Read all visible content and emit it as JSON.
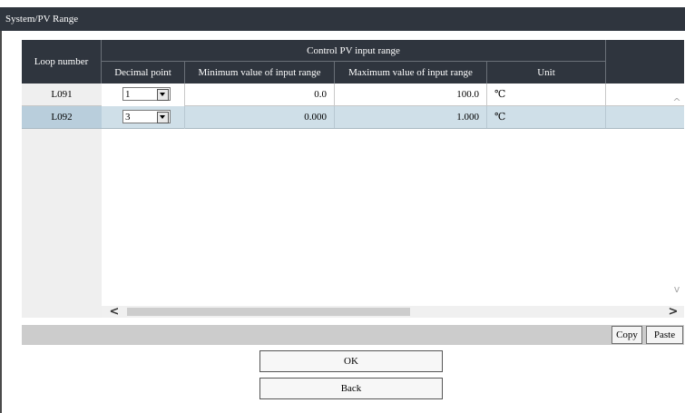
{
  "window": {
    "title": "System/PV Range"
  },
  "table": {
    "headers": {
      "loop_number": "Loop number",
      "group": "Control PV input range",
      "decimal_point": "Decimal point",
      "min_range": "Minimum value of input range",
      "max_range": "Maximum value of input range",
      "unit": "Unit"
    },
    "rows": [
      {
        "loop": "L091",
        "decimal_point": "1",
        "min": "0.0",
        "max": "100.0",
        "unit": "℃",
        "selected": false
      },
      {
        "loop": "L092",
        "decimal_point": "3",
        "min": "0.000",
        "max": "1.000",
        "unit": "℃",
        "selected": true
      }
    ]
  },
  "scroll": {
    "left_arrow": "<",
    "right_arrow": ">",
    "up_arrow": "^",
    "down_arrow": "v"
  },
  "toolbar": {
    "copy_label": "Copy",
    "paste_label": "Paste"
  },
  "actions": {
    "ok_label": "OK",
    "back_label": "Back"
  },
  "colors": {
    "header_bg": "#2f353e",
    "selected_row": "#cfdfe8",
    "bar_bg": "#cccccc"
  }
}
